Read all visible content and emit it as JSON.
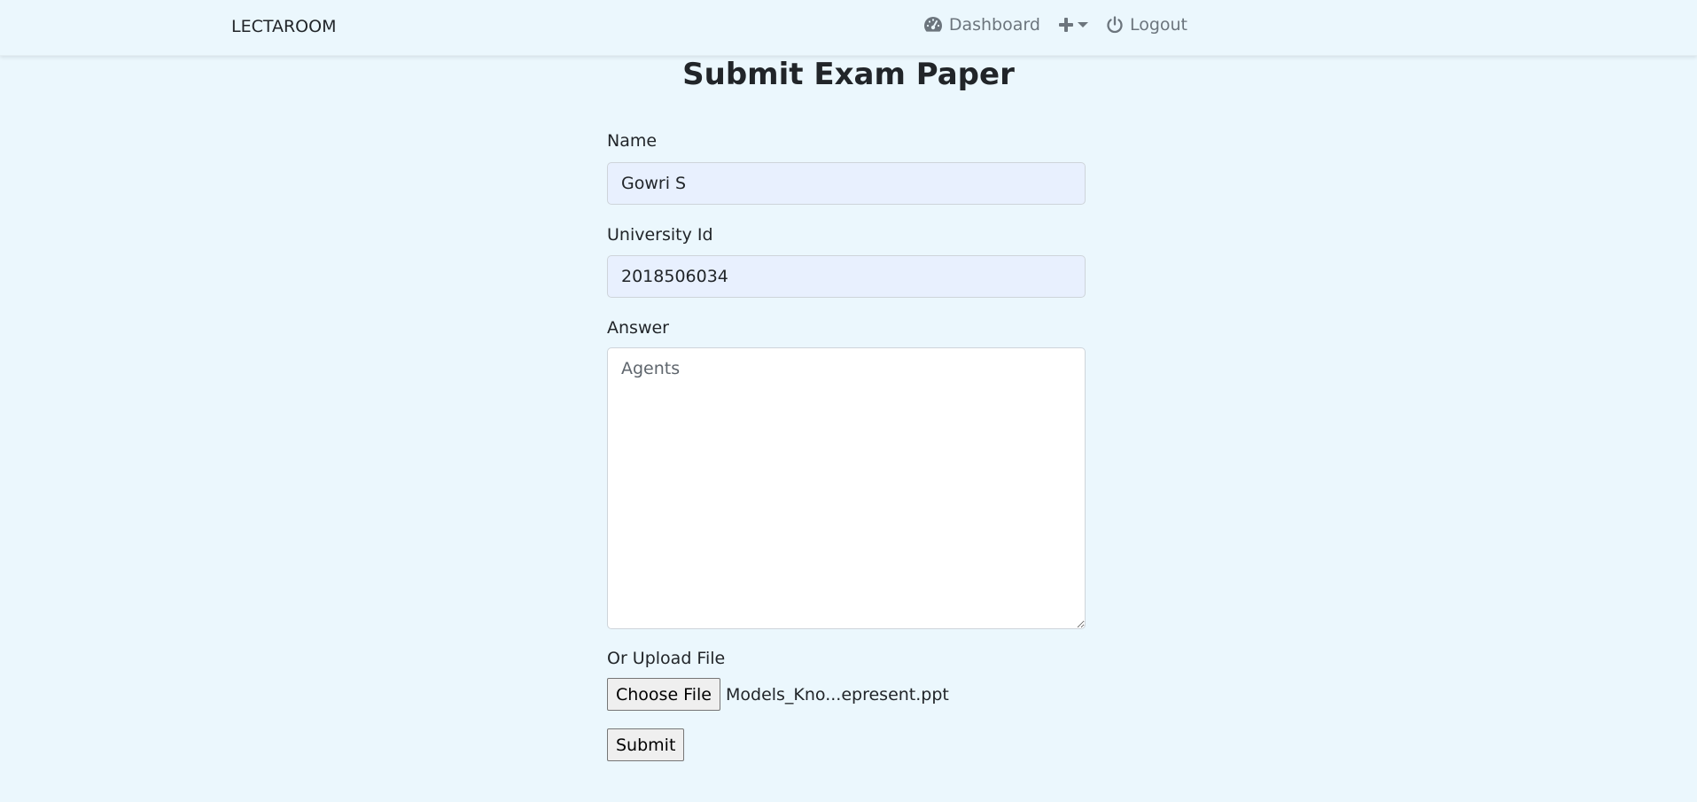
{
  "navbar": {
    "brand": "LECTAROOM",
    "dashboard_label": "Dashboard",
    "logout_label": "Logout",
    "icons": [
      "dashboard-icon",
      "plus-icon",
      "caret-down-icon",
      "power-icon"
    ]
  },
  "page": {
    "title": "Submit Exam Paper"
  },
  "form": {
    "name_label": "Name",
    "name_value": "Gowri S",
    "university_id_label": "University Id",
    "university_id_value": "2018506034",
    "answer_label": "Answer",
    "answer_placeholder": "Agents",
    "upload_label": "Or Upload File",
    "choose_file_label": "Choose File",
    "file_name": "Models_Kno...epresent.ppt",
    "submit_label": "Submit"
  },
  "colors": {
    "background": "#ebf7fd",
    "input_autofill": "#e8f0fe",
    "nav_text": "#6c757d",
    "text": "#212529"
  }
}
